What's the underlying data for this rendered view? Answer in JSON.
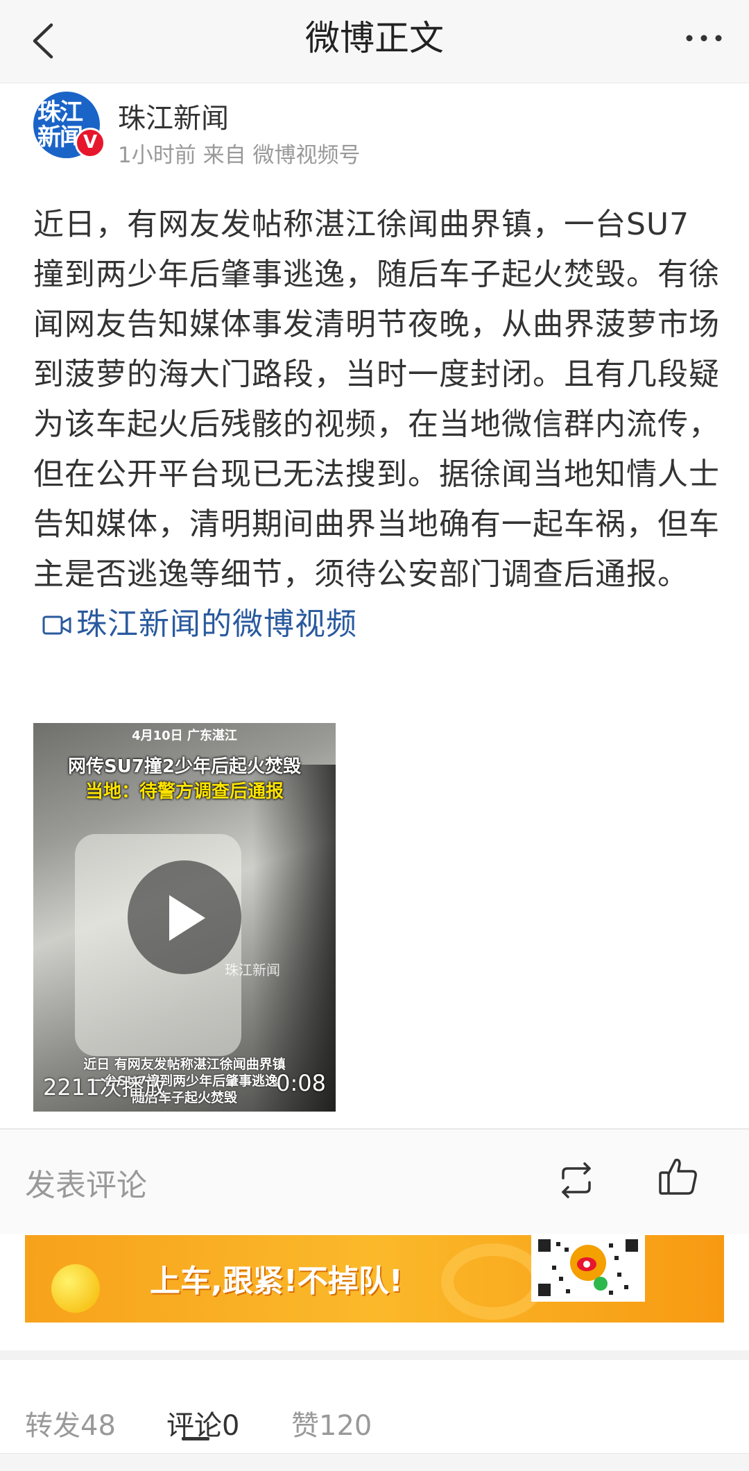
{
  "header": {
    "title": "微博正文",
    "back_icon": "chevron-left-icon",
    "more_icon": "more-dots-icon"
  },
  "author": {
    "name": "珠江新闻",
    "avatar_text_line1": "珠江",
    "avatar_text_line2": "新闻",
    "verified_badge": "V",
    "time": "1小时前",
    "source": "来自 微博视频号"
  },
  "post": {
    "text": "近日，有网友发帖称湛江徐闻曲界镇，一台SU7撞到两少年后肇事逃逸，随后车子起火焚毁。有徐闻网友告知媒体事发清明节夜晚，从曲界菠萝市场到菠萝的海大门路段，当时一度封闭。且有几段疑为该车起火后残骸的视频，在当地微信群内流传，但在公开平台现已无法搜到。据徐闻当地知情人士告知媒体，清明期间曲界当地确有一起车祸，但车主是否逃逸等细节，须待公安部门调查后通报。",
    "video_link": "珠江新闻的微博视频"
  },
  "video": {
    "date_tag": "4月10日 广东湛江",
    "headline_line1": "网传SU7撞2少年后起火焚毁",
    "headline_line2": "当地：待警方调查后通报",
    "watermark": "珠江新闻",
    "subtitle_line1": "近日 有网友发帖称湛江徐闻曲界镇",
    "subtitle_line2": "一台SU7撞到两少年后肇事逃逸",
    "subtitle_line3": "随后车子起火焚毁",
    "play_count": "2211次播放",
    "duration": "0:08"
  },
  "comment_bar": {
    "placeholder": "发表评论",
    "repost_icon": "repost-icon",
    "like_icon": "thumb-up-icon"
  },
  "banner": {
    "text": "上车,跟紧!不掉队!"
  },
  "tabs": [
    {
      "label": "转发48"
    },
    {
      "label": "评论0"
    },
    {
      "label": "赞120"
    }
  ],
  "colors": {
    "link": "#2a5a9e",
    "verified": "#e6162d",
    "banner": "#f7a21b"
  }
}
